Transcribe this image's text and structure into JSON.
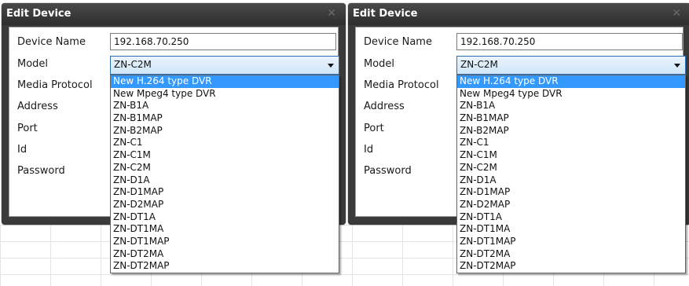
{
  "dialogs": [
    {
      "title": "Edit Device",
      "close_glyph": "✕",
      "labels": {
        "device_name": "Device Name",
        "model": "Model",
        "media_protocol": "Media Protocol",
        "address": "Address",
        "port": "Port",
        "id": "Id",
        "password": "Password"
      },
      "device_name_value": "192.168.70.250",
      "model_value": "ZN-C2M",
      "options": [
        "New H.264 type DVR",
        "New Mpeg4 type DVR",
        "ZN-B1A",
        "ZN-B1MAP",
        "ZN-B2MAP",
        "ZN-C1",
        "ZN-C1M",
        "ZN-C2M",
        "ZN-D1A",
        "ZN-D1MAP",
        "ZN-D2MAP",
        "ZN-DT1A",
        "ZN-DT1MA",
        "ZN-DT1MAP",
        "ZN-DT2MA",
        "ZN-DT2MAP"
      ],
      "highlighted_option": "New H.264 type DVR"
    },
    {
      "title": "Edit Device",
      "close_glyph": "✕",
      "labels": {
        "device_name": "Device Name",
        "model": "Model",
        "media_protocol": "Media Protocol",
        "address": "Address",
        "port": "Port",
        "id": "Id",
        "password": "Password"
      },
      "device_name_value": "192.168.70.250",
      "model_value": "ZN-C2M",
      "options": [
        "New H.264 type DVR",
        "New Mpeg4 type DVR",
        "ZN-B1A",
        "ZN-B1MAP",
        "ZN-B2MAP",
        "ZN-C1",
        "ZN-C1M",
        "ZN-C2M",
        "ZN-D1A",
        "ZN-D1MAP",
        "ZN-D2MAP",
        "ZN-DT1A",
        "ZN-DT1MA",
        "ZN-DT1MAP",
        "ZN-DT2MA",
        "ZN-DT2MAP"
      ],
      "highlighted_option": "New H.264 type DVR"
    }
  ],
  "colors": {
    "dialog_frame": "#3a3a3a",
    "selection_highlight": "#3399ff",
    "combo_focus_border": "#2f6fb0"
  },
  "icons": {
    "close": "close-icon",
    "dropdown_arrow": "chevron-down-icon"
  }
}
